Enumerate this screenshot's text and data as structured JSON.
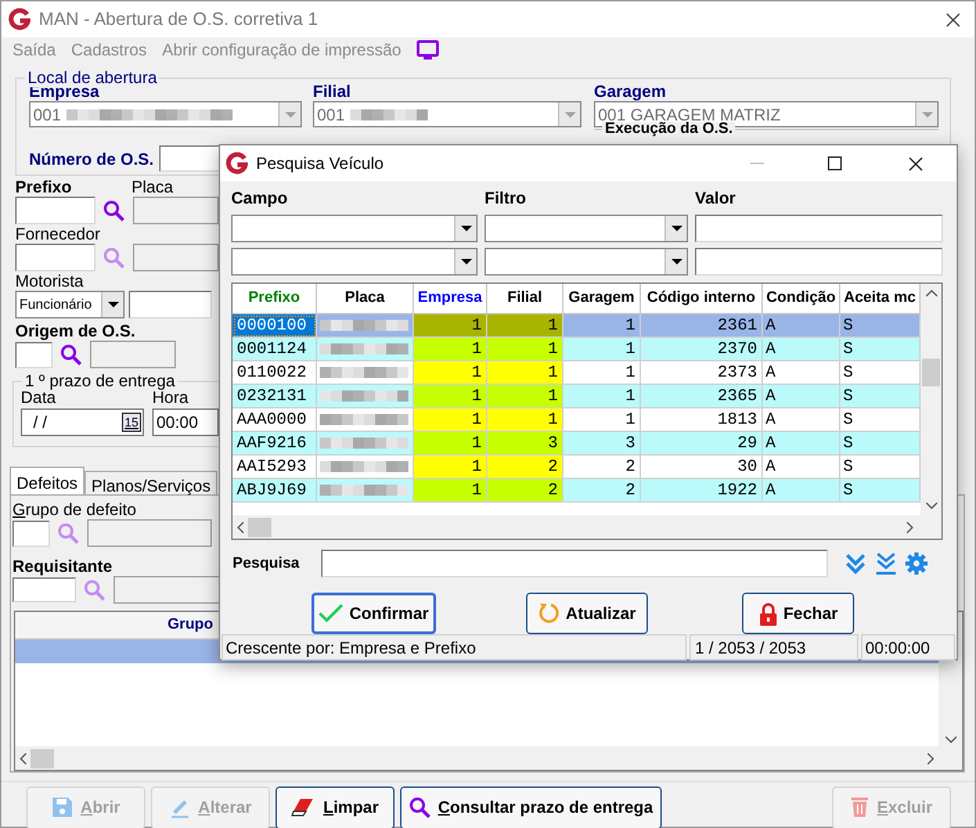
{
  "window": {
    "title": "MAN - Abertura de O.S. corretiva 1"
  },
  "menu": [
    {
      "label": "Saída"
    },
    {
      "label": "Cadastros"
    },
    {
      "label": "Abrir configuração de impressão"
    }
  ],
  "local_de_abertura": {
    "title": "Local de abertura",
    "fields": [
      {
        "label": "Empresa",
        "value": "001",
        "disabled": true,
        "redacted": true
      },
      {
        "label": "Filial",
        "value": "001",
        "disabled": true,
        "redacted": true
      },
      {
        "label": "Garagem",
        "value": "001 GARAGEM MATRIZ",
        "disabled": true,
        "redacted": false
      }
    ],
    "numero_os_label": "Número de O.S.",
    "execucao_title": "Execução da O.S."
  },
  "prefixo": {
    "label": "Prefixo",
    "lookup_disabled": false
  },
  "placa": {
    "label": "Placa"
  },
  "fornecedor": {
    "label": "Fornecedor",
    "lookup_disabled": true
  },
  "motorista": {
    "label": "Motorista",
    "type": "Funcionário"
  },
  "origem": {
    "label": "Origem de O.S.",
    "lookup_disabled": false
  },
  "prazo": {
    "title": "1 º prazo de entrega",
    "data_label": "Data",
    "data_value": "/ /",
    "calendar_day": "15",
    "hora_label": "Hora",
    "hora_value": "00:00"
  },
  "tabs": [
    {
      "label": "Defeitos",
      "selected": true
    },
    {
      "label": "Planos/Serviços",
      "selected": false
    }
  ],
  "grupo_defeito": {
    "label": "Grupo de defeito",
    "lookup_disabled": true
  },
  "requisitante": {
    "label": "Requisitante",
    "lookup_disabled": true
  },
  "defects_grid": {
    "columns": [
      {
        "label": "Grupo"
      }
    ],
    "rows": [
      {
        "selected": true
      }
    ]
  },
  "buttons": [
    {
      "kind": "save",
      "label": "Abrir",
      "disabled": true
    },
    {
      "kind": "edit",
      "label": "Alterar",
      "disabled": true
    },
    {
      "kind": "eraser",
      "label": "Limpar",
      "disabled": false
    },
    {
      "kind": "search",
      "label": "Consultar prazo de entrega",
      "disabled": false
    },
    {
      "kind": "delete",
      "label": "Excluir",
      "disabled": true
    }
  ],
  "dialog": {
    "title": "Pesquisa Veículo",
    "filter_labels": [
      "Campo",
      "Filtro",
      "Valor"
    ],
    "grid": {
      "columns": [
        {
          "label": "Prefixo",
          "kind": "code",
          "color": "#008000"
        },
        {
          "label": "Placa",
          "kind": "redacted",
          "color": "#000000"
        },
        {
          "label": "Empresa",
          "kind": "highlight",
          "color": "#0000ff"
        },
        {
          "label": "Filial",
          "kind": "highlight",
          "color": "#000000"
        },
        {
          "label": "Garagem",
          "kind": "number",
          "color": "#000000"
        },
        {
          "label": "Código interno",
          "kind": "number",
          "color": "#000000"
        },
        {
          "label": "Condição",
          "kind": "text",
          "color": "#000000"
        },
        {
          "label": "Aceita mc",
          "kind": "text",
          "color": "#000000"
        }
      ],
      "rows": [
        {
          "cells": [
            "0000100",
            "",
            "1",
            "1",
            "1",
            "2361",
            "A",
            "S"
          ],
          "selected": true
        },
        {
          "cells": [
            "0001124",
            "",
            "1",
            "1",
            "1",
            "2370",
            "A",
            "S"
          ],
          "selected": false
        },
        {
          "cells": [
            "0110022",
            "",
            "1",
            "1",
            "1",
            "2373",
            "A",
            "S"
          ],
          "selected": false
        },
        {
          "cells": [
            "0232131",
            "",
            "1",
            "1",
            "1",
            "2365",
            "A",
            "S"
          ],
          "selected": false
        },
        {
          "cells": [
            "AAA0000",
            "",
            "1",
            "1",
            "1",
            "1813",
            "A",
            "S"
          ],
          "selected": false
        },
        {
          "cells": [
            "AAF9216",
            "",
            "1",
            "3",
            "3",
            "29",
            "A",
            "S"
          ],
          "selected": false
        },
        {
          "cells": [
            "AAI5293",
            "",
            "1",
            "2",
            "2",
            "30",
            "A",
            "S"
          ],
          "selected": false
        },
        {
          "cells": [
            "ABJ9J69",
            "",
            "1",
            "2",
            "2",
            "1922",
            "A",
            "S"
          ],
          "selected": false
        }
      ]
    },
    "search_label": "Pesquisa",
    "buttons": [
      {
        "kind": "confirm",
        "label": "Confirmar",
        "default": true
      },
      {
        "kind": "refresh",
        "label": "Atualizar",
        "default": false
      },
      {
        "kind": "lock",
        "label": "Fechar",
        "default": false
      }
    ],
    "status": {
      "order": "Crescente por: Empresa e Prefixo",
      "count": "1 / 2053 / 2053",
      "time": "00:00:00"
    }
  }
}
